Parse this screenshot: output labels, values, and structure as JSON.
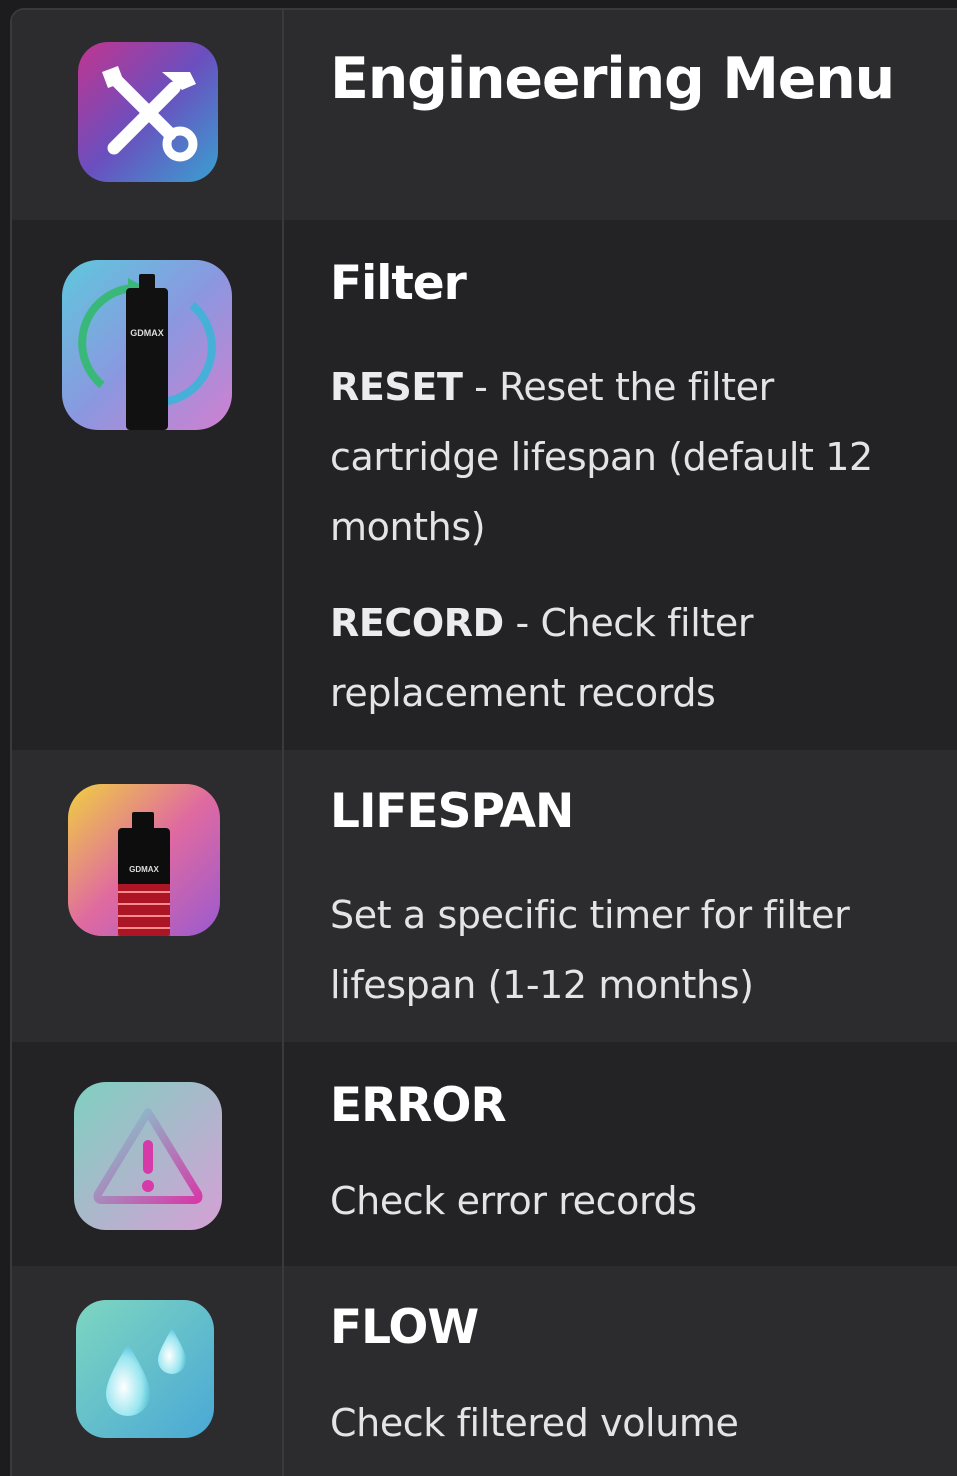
{
  "header": {
    "title": "Engineering Menu",
    "icon": "tools-icon"
  },
  "sections": [
    {
      "id": "filter",
      "title": "Filter",
      "icon": "filter-cartridge-cycle-icon",
      "items": [
        {
          "key": "RESET",
          "separator": " - ",
          "text": "Reset the filter cartridge lifespan (default 12 months)"
        },
        {
          "key": "RECORD",
          "separator": " - ",
          "text": "Check filter replacement records"
        }
      ],
      "brand": "GDMAX"
    },
    {
      "id": "lifespan",
      "title": "LIFESPAN",
      "icon": "filter-cartridge-timer-icon",
      "text": "Set a specific timer for filter lifespan (1-12 months)",
      "brand": "GDMAX"
    },
    {
      "id": "error",
      "title": "ERROR",
      "icon": "warning-triangle-icon",
      "text": "Check error records"
    },
    {
      "id": "flow",
      "title": "FLOW",
      "icon": "water-drops-icon",
      "text": "Check filtered volume"
    }
  ],
  "colors": {
    "row_light": "#2c2c2e",
    "row_dark": "#232325",
    "text": "#ffffff",
    "desc": "#e4e4e6"
  }
}
